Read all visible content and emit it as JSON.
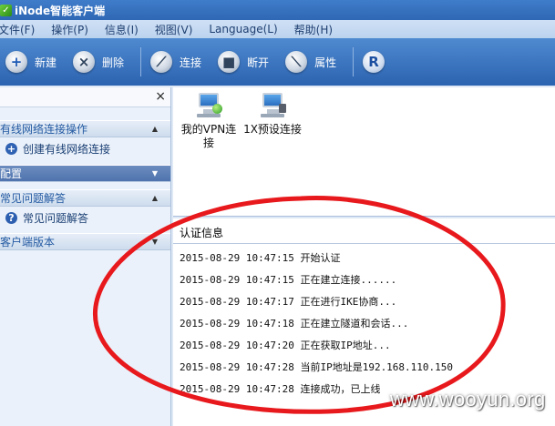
{
  "app": {
    "title": "iNode智能客户端"
  },
  "menu": [
    "文件(F)",
    "操作(P)",
    "信息(I)",
    "视图(V)",
    "Language(L)",
    "帮助(H)"
  ],
  "toolbar": {
    "new": "新建",
    "delete": "删除",
    "connect": "连接",
    "disconnect": "断开",
    "properties": "属性",
    "logo": "R"
  },
  "sidebar": {
    "close": "×",
    "wired_section": "有线网络连接操作",
    "create_wired": "创建有线网络连接",
    "config_section": "配置",
    "faq_section": "常见问题解答",
    "faq_link": "常见问题解答",
    "version_section": "客户端版本"
  },
  "connections": [
    {
      "line1": "我的VPN连",
      "line2": "接"
    },
    {
      "line1": "1X预设连接",
      "line2": ""
    }
  ],
  "auth": {
    "title": "认证信息",
    "logs": [
      "2015-08-29 10:47:15 开始认证",
      "2015-08-29 10:47:15 正在建立连接......",
      "2015-08-29 10:47:17 正在进行IKE协商...",
      "2015-08-29 10:47:18 正在建立隧道和会话...",
      "2015-08-29 10:47:20 正在获取IP地址...",
      "2015-08-29 10:47:28 当前IP地址是192.168.110.150",
      "2015-08-29 10:47:28 连接成功，已上线"
    ]
  },
  "watermark": "www.wooyun.org",
  "colors": {
    "annotation_circle": "#e8191d",
    "toolbar": "#3a72bd",
    "titlebar": "#3a75c4"
  }
}
